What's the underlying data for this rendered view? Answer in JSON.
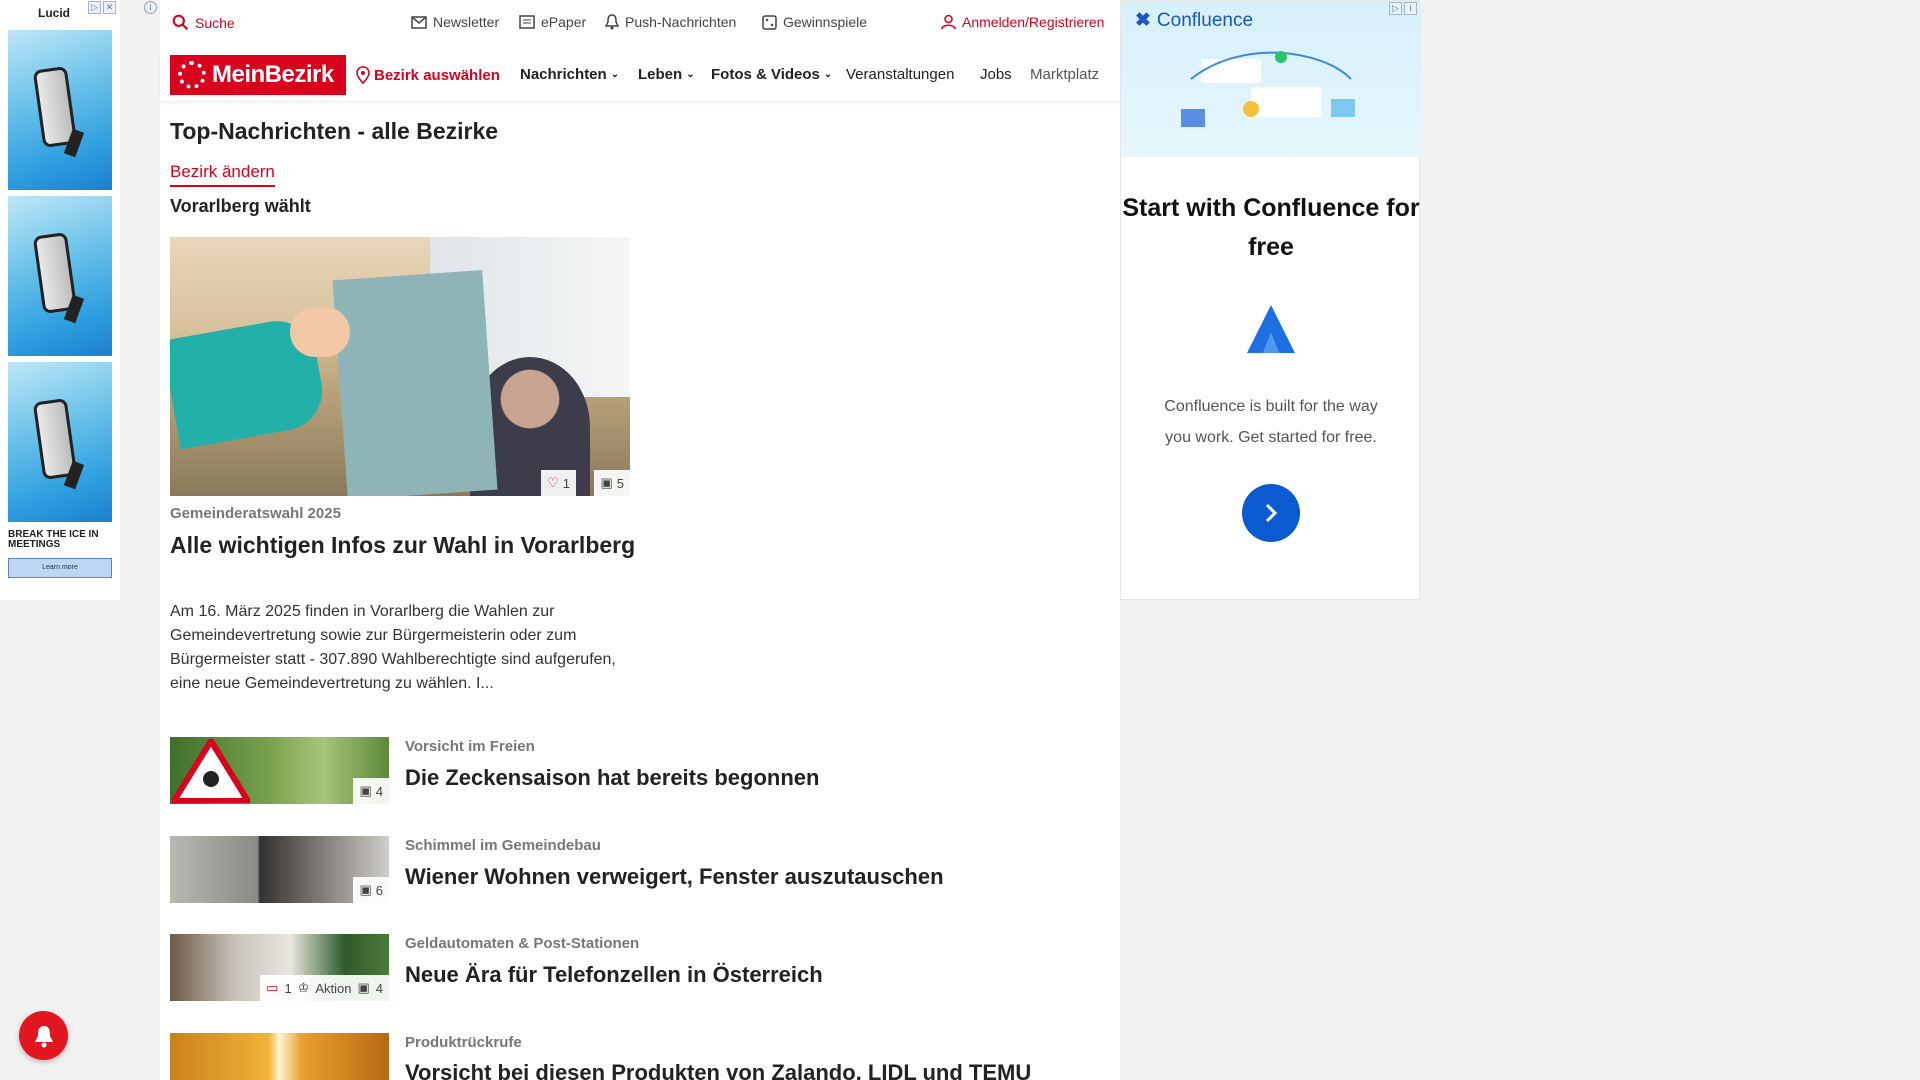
{
  "left_ad": {
    "brand": "Lucid",
    "headline": "BREAK THE ICE IN MEETINGS",
    "cta": "Learn more"
  },
  "utility": {
    "search": "Suche",
    "newsletter": "Newsletter",
    "epaper": "ePaper",
    "push": "Push-Nachrichten",
    "games": "Gewinnspiele",
    "login": "Anmelden/Registrieren"
  },
  "nav": {
    "logo": "MeinBezirk",
    "district": "Bezirk auswählen",
    "items": [
      "Nachrichten",
      "Leben",
      "Fotos & Videos",
      "Veranstaltungen",
      "Jobs",
      "Marktplatz"
    ]
  },
  "page": {
    "title": "Top-Nachrichten - alle Bezirke",
    "change_district": "Bezirk ändern",
    "section": "Vorarlberg wählt"
  },
  "lead": {
    "likes": "1",
    "images": "5",
    "kicker": "Gemeinderatswahl 2025",
    "headline": "Alle wichtigen Infos zur Wahl in Vorarlberg",
    "text": "Am 16. März 2025 finden in Vorarlberg die Wahlen zur Gemeindevertretung sowie zur Bürgermeisterin oder zum Bürgermeister statt - 307.890 Wahlberechtigte sind aufgerufen, eine neue Gemeindevertretung zu wählen. I..."
  },
  "articles": [
    {
      "kicker": "Vorsicht im Freien",
      "headline": "Die Zeckensaison hat bereits begonnen",
      "images": "4"
    },
    {
      "kicker": "Schimmel im Gemeindebau",
      "headline": "Wiener Wohnen verweigert, Fenster auszutauschen",
      "images": "6"
    },
    {
      "kicker": "Geldautomaten & Post-Stationen",
      "headline": "Neue Ära für Telefonzellen in Österreich",
      "comments": "1",
      "action": "Aktion",
      "images": "4"
    },
    {
      "kicker": "Produktrückrufe",
      "headline": "Vorsicht bei diesen Produkten von Zalando, LIDL und TEMU"
    }
  ],
  "right_ad": {
    "brand": "Confluence",
    "title": "Start with Confluence for free",
    "body": "Confluence is built for the way you work. Get started for free."
  },
  "colors": {
    "brand_red": "#d9001d",
    "ad_blue": "#0b5ad0"
  }
}
